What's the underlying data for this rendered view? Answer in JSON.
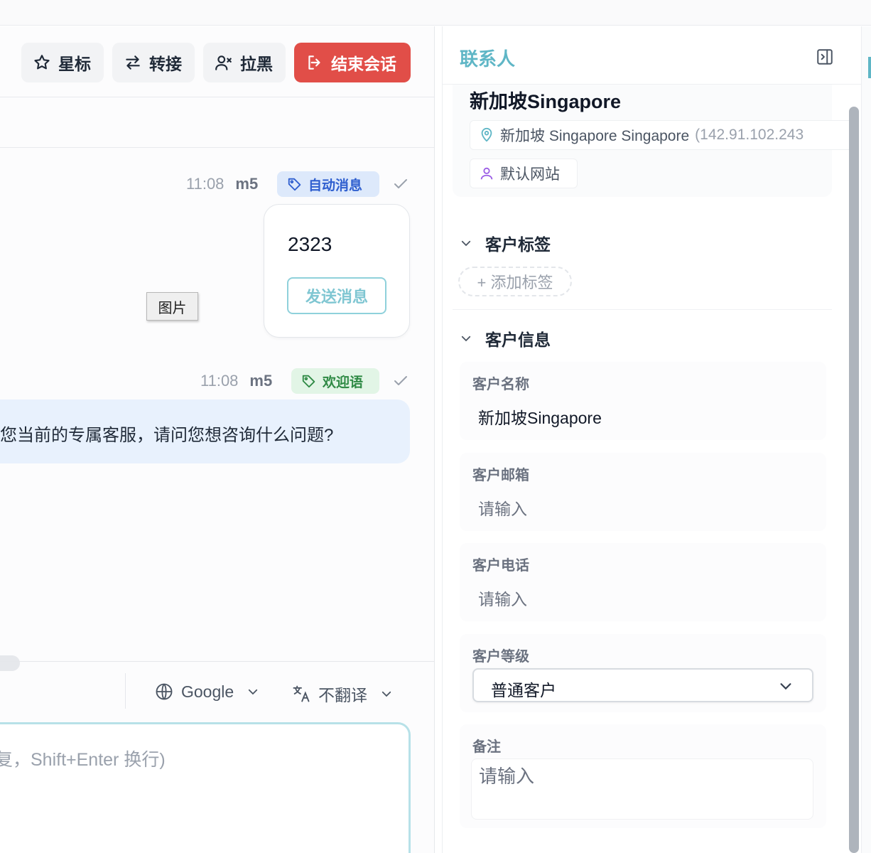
{
  "toolbar": {
    "star_label": "星标",
    "transfer_label": "转接",
    "block_label": "拉黑",
    "end_label": "结束会话"
  },
  "messages": [
    {
      "time": "11:08",
      "sender": "m5",
      "tag": "自动消息",
      "card_text": "2323",
      "card_button": "发送消息",
      "tooltip": "图片"
    },
    {
      "time": "11:08",
      "sender": "m5",
      "tag": "欢迎语",
      "text": "您当前的专属客服，请问您想咨询什么问题?"
    }
  ],
  "composer": {
    "engine": "Google",
    "translate": "不翻译",
    "placeholder": "复，Shift+Enter 换行)"
  },
  "contact": {
    "panel_title": "联系人",
    "name": "新加坡Singapore",
    "location": "新加坡 Singapore Singapore",
    "ip": "(142.91.102.243",
    "site": "默认网站",
    "tags_section": "客户标签",
    "add_tag": "+ 添加标签",
    "info_section": "客户信息",
    "fields": {
      "name_label": "客户名称",
      "name_value": "新加坡Singapore",
      "email_label": "客户邮箱",
      "email_placeholder": "请输入",
      "phone_label": "客户电话",
      "phone_placeholder": "请输入",
      "level_label": "客户等级",
      "level_value": "普通客户",
      "note_label": "备注",
      "note_placeholder": "请输入"
    }
  },
  "colors": {
    "accent": "#5fb6c6",
    "danger": "#e14e48",
    "auto_tag_bg": "#dde9fb",
    "auto_tag_fg": "#2f5fcf",
    "welcome_tag_bg": "#e2f5e6",
    "welcome_tag_fg": "#2f8a45"
  }
}
